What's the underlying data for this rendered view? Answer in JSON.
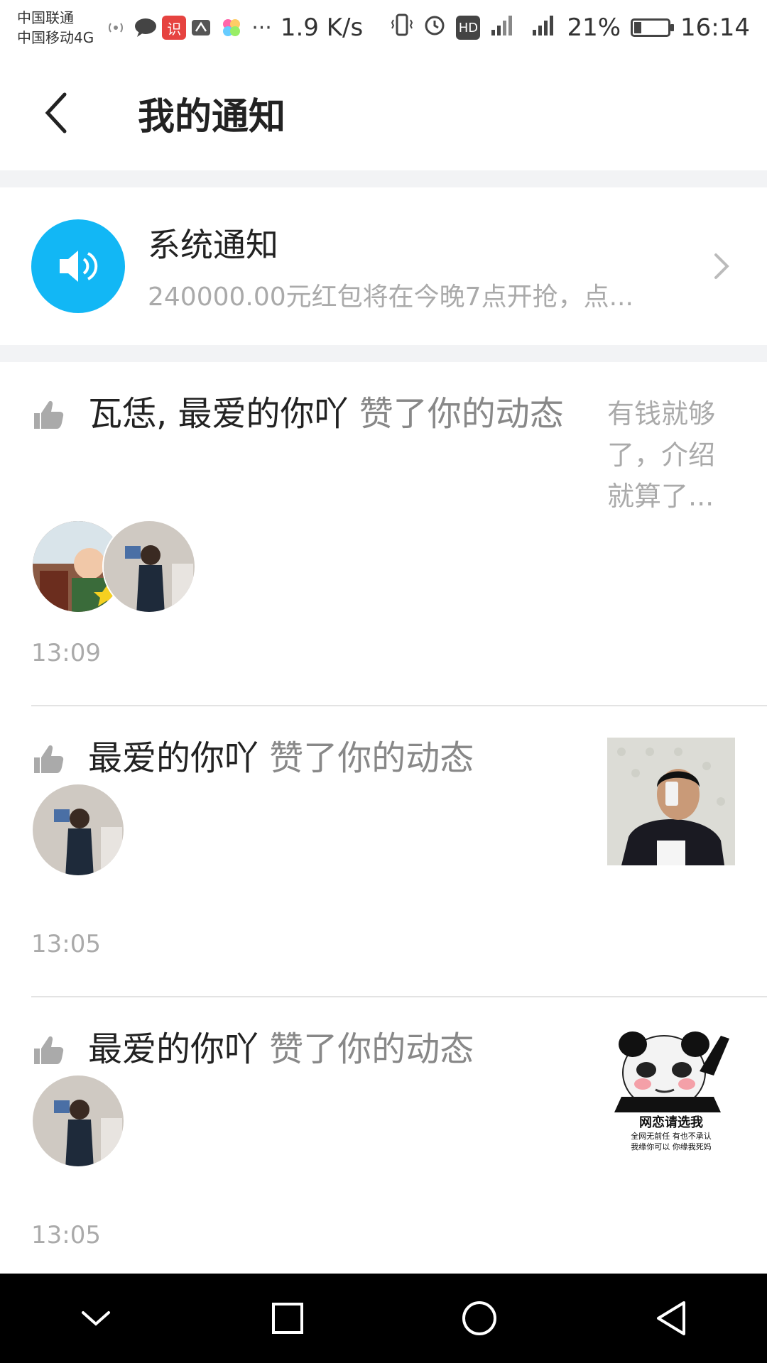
{
  "status_bar": {
    "carrier1": "中国联通",
    "carrier2": "中国移动4G",
    "speed": "1.9 K/s",
    "battery": "21%",
    "battery_level": 0.21,
    "time": "16:14",
    "icons": [
      "hotspot-icon",
      "chat-bubble-icon",
      "app-shi-icon",
      "huawei-icon",
      "gallery-icon",
      "more-icon",
      "vibrate-icon",
      "alarm-icon",
      "hd-icon",
      "signal-icon",
      "signal-4g-icon",
      "battery-icon"
    ],
    "badge_shi": "识",
    "badge_hd": "HD",
    "badge_dots": "···"
  },
  "header": {
    "title": "我的通知"
  },
  "system_notice": {
    "title": "系统通知",
    "subtitle": "240000.00元红包将在今晚7点开抢，点...",
    "icon": "speaker-icon",
    "accent": "#12b7f5"
  },
  "notifications": [
    {
      "actors": "瓦恁, 最爱的你吖",
      "action": "赞了你的动态",
      "preview_text": "有钱就够了，介绍就算了...",
      "time": "13:09",
      "avatar_count": 2
    },
    {
      "actors": "最爱的你吖",
      "action": "赞了你的动态",
      "preview_image": "selfie-photo",
      "time": "13:05",
      "avatar_count": 1
    },
    {
      "actors": "最爱的你吖",
      "action": "赞了你的动态",
      "preview_image": "panda-meme",
      "meme_caption": "网恋请选我",
      "meme_line1": "全网无前任 有也不承认",
      "meme_line2": "我缘你可以 你缘我死妈",
      "time": "13:05",
      "avatar_count": 1
    }
  ],
  "nav": {
    "buttons": [
      "collapse-icon",
      "recent-apps-icon",
      "home-icon",
      "back-icon"
    ]
  }
}
